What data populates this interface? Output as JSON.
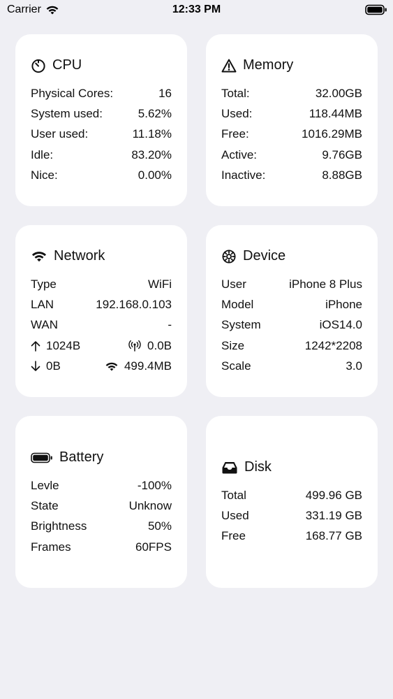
{
  "status_bar": {
    "carrier": "Carrier",
    "time": "12:33 PM",
    "wifi_icon": "wifi-icon",
    "battery_icon": "battery-full-icon"
  },
  "cpu": {
    "title": "CPU",
    "icon": "timer-icon",
    "rows": [
      {
        "label": "Physical Cores:",
        "value": "16"
      },
      {
        "label": "System used:",
        "value": "5.62%"
      },
      {
        "label": "User used:",
        "value": "11.18%"
      },
      {
        "label": "Idle:",
        "value": "83.20%"
      },
      {
        "label": "Nice:",
        "value": "0.00%"
      }
    ]
  },
  "memory": {
    "title": "Memory",
    "icon": "warning-triangle-icon",
    "rows": [
      {
        "label": "Total:",
        "value": "32.00GB"
      },
      {
        "label": "Used:",
        "value": "118.44MB"
      },
      {
        "label": "Free:",
        "value": "1016.29MB"
      },
      {
        "label": "Active:",
        "value": "9.76GB"
      },
      {
        "label": "Inactive:",
        "value": "8.88GB"
      }
    ]
  },
  "network": {
    "title": "Network",
    "icon": "wifi-icon",
    "rows": [
      {
        "label": "Type",
        "value": "WiFi"
      },
      {
        "label": "LAN",
        "value": "192.168.0.103"
      },
      {
        "label": "WAN",
        "value": "-"
      }
    ],
    "upload": {
      "icon": "arrow-up-icon",
      "value": "1024B"
    },
    "cellular": {
      "icon": "antenna-icon",
      "value": "0.0B"
    },
    "download": {
      "icon": "arrow-down-icon",
      "value": "0B"
    },
    "wifi_traffic": {
      "icon": "wifi-icon",
      "value": "499.4MB"
    }
  },
  "device": {
    "title": "Device",
    "icon": "gear-icon",
    "rows": [
      {
        "label": "User",
        "value": "iPhone 8 Plus"
      },
      {
        "label": "Model",
        "value": "iPhone"
      },
      {
        "label": "System",
        "value": "iOS14.0"
      },
      {
        "label": "Size",
        "value": "1242*2208"
      },
      {
        "label": "Scale",
        "value": "3.0"
      }
    ]
  },
  "battery": {
    "title": "Battery",
    "icon": "battery-icon",
    "rows": [
      {
        "label": "Levle",
        "value": "-100%"
      },
      {
        "label": "State",
        "value": "Unknow"
      },
      {
        "label": "Brightness",
        "value": "50%"
      },
      {
        "label": "Frames",
        "value": "60FPS"
      }
    ]
  },
  "disk": {
    "title": "Disk",
    "icon": "tray-icon",
    "rows": [
      {
        "label": "Total",
        "value": "499.96 GB"
      },
      {
        "label": "Used",
        "value": "331.19 GB"
      },
      {
        "label": "Free",
        "value": "168.77 GB"
      }
    ]
  }
}
